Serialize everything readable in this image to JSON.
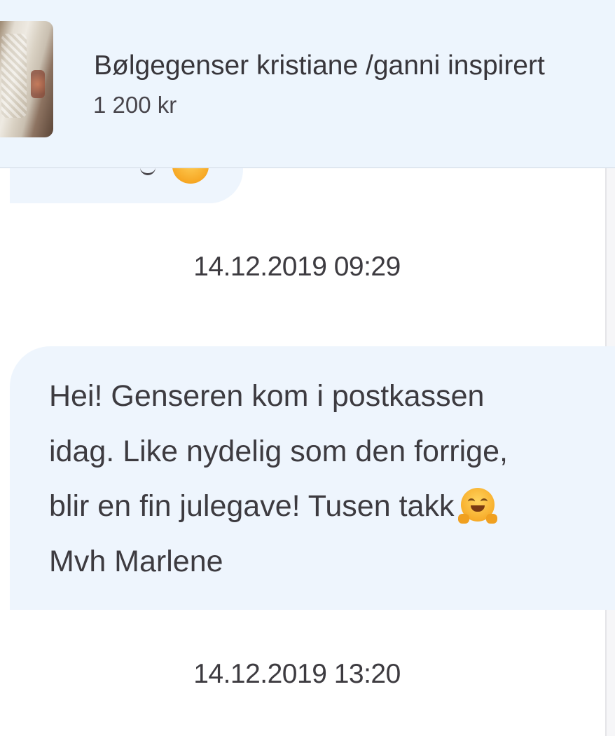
{
  "listing": {
    "title": "Bølgegenser kristiane /ganni inspirert",
    "price": "1 200 kr",
    "thumbnail_icon": "knitted-sweater-photo"
  },
  "conversation": {
    "previous_message": {
      "emoji_icon": "smiling-face-emoji"
    },
    "timestamp_1": "14.12.2019 09:29",
    "message": {
      "line_1": "Hei! Genseren kom i postkassen",
      "line_2": "idag. Like nydelig som den forrige,",
      "line_3": "blir en fin julegave! Tusen takk",
      "line_4": "Mvh Marlene",
      "emoji_icon": "hugging-face-emoji"
    },
    "timestamp_2": "14.12.2019 13:20"
  },
  "colors": {
    "header_background": "#edf5fd",
    "bubble_background": "#eef5fd",
    "text": "#3d3b40"
  }
}
